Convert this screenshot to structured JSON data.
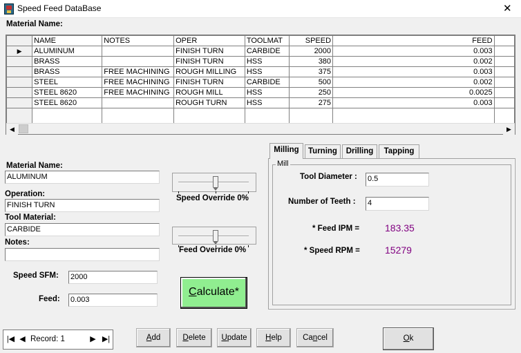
{
  "window": {
    "title": "Speed Feed DataBase",
    "close_glyph": "✕"
  },
  "grid_caption": "Material Name:",
  "table": {
    "columns": [
      "NAME",
      "NOTES",
      "OPER",
      "TOOLMAT",
      "SPEED",
      "FEED"
    ],
    "rows": [
      [
        "ALUMINUM",
        "",
        "FINISH TURN",
        "CARBIDE",
        "2000",
        "0.003"
      ],
      [
        "BRASS",
        "",
        "FINISH TURN",
        "HSS",
        "380",
        "0.002"
      ],
      [
        "BRASS",
        "FREE MACHINING",
        "ROUGH MILLING",
        "HSS",
        "375",
        "0.003"
      ],
      [
        "STEEL",
        "FREE MACHINING",
        "FINISH TURN",
        "CARBIDE",
        "500",
        "0.002"
      ],
      [
        "STEEL 8620",
        "FREE MACHINING",
        "ROUGH MILL",
        "HSS",
        "250",
        "0.0025"
      ],
      [
        "STEEL 8620",
        "",
        "ROUGH TURN",
        "HSS",
        "275",
        "0.003"
      ]
    ],
    "current_row_marker": "▶"
  },
  "form": {
    "material_name_label": "Material Name:",
    "material_name_value": "ALUMINUM",
    "operation_label": "Operation:",
    "operation_value": "FINISH TURN",
    "tool_material_label": "Tool Material:",
    "tool_material_value": "CARBIDE",
    "notes_label": "Notes:",
    "notes_value": "",
    "speed_sfm_label": "Speed SFM:",
    "speed_sfm_value": "2000",
    "feed_label": "Feed:",
    "feed_value": "0.003"
  },
  "sliders": {
    "speed_label": "Speed Override 0%",
    "speed_value": 0,
    "feed_label": "Feed Override 0%",
    "feed_value": 0
  },
  "calculate": {
    "label_underlined": "C",
    "label_rest": "alculate*"
  },
  "tabs": [
    {
      "label": "Milling",
      "active": true
    },
    {
      "label": "Turning",
      "active": false
    },
    {
      "label": "Drilling",
      "active": false
    },
    {
      "label": "Tapping",
      "active": false
    }
  ],
  "mill": {
    "group_label": "Mill",
    "tool_diameter_label": "Tool Diameter :",
    "tool_diameter_value": "0.5",
    "teeth_label": "Number of Teeth :",
    "teeth_value": "4",
    "feed_ipm_label": "* Feed IPM =",
    "feed_ipm_value": "183.35",
    "speed_rpm_label": "* Speed RPM =",
    "speed_rpm_value": "15279",
    "result_color": "#800080"
  },
  "navigator": {
    "first": "|◀",
    "prev": "◀",
    "record_label": "Record: 1",
    "next": "▶",
    "last": "▶|"
  },
  "buttons": {
    "add_u": "A",
    "add_rest": "dd",
    "delete_u": "D",
    "delete_rest": "elete",
    "update_u": "U",
    "update_rest": "pdate",
    "help_u": "H",
    "help_rest": "elp",
    "cancel_pre": "Ca",
    "cancel_u": "n",
    "cancel_rest": "cel",
    "ok_u": "O",
    "ok_rest": "k"
  },
  "scroll": {
    "left": "◀",
    "right": "▶"
  }
}
